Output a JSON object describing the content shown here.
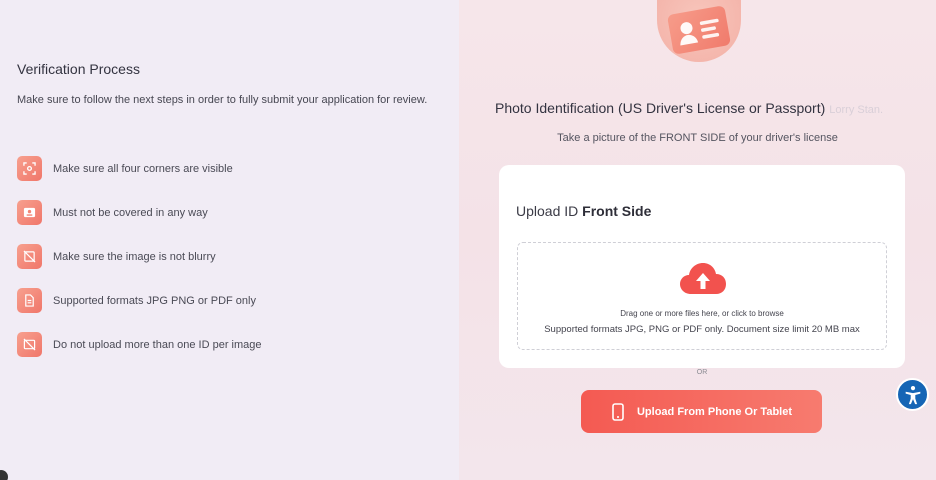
{
  "process": {
    "title": "Verification Process",
    "description": "Make sure to follow the next steps in order to fully submit your application for review.",
    "steps": [
      {
        "label": "Make sure all four corners are visible",
        "icon": "corners-icon"
      },
      {
        "label": "Must not be covered in any way",
        "icon": "card-icon"
      },
      {
        "label": "Make sure the image is not blurry",
        "icon": "blur-icon"
      },
      {
        "label": "Supported formats JPG PNG or PDF only",
        "icon": "file-icon"
      },
      {
        "label": "Do not upload more than one ID per image",
        "icon": "no-image-icon"
      }
    ]
  },
  "upload": {
    "heading": "Photo Identification (US Driver's License or Passport)",
    "heading_faded": "Lorry Stan.",
    "hint": "Take a picture of the FRONT SIDE of your driver's license",
    "card_title_prefix": "Upload ID",
    "card_title_bold": "Front Side",
    "drop_line1": "Drag one or more files here, or click to browse",
    "drop_line2": "Supported formats JPG, PNG or PDF only. Document size limit 20 MB max",
    "or": "OR",
    "phone_button": "Upload From Phone Or Tablet"
  },
  "colors": {
    "accent": "#f45a52",
    "accent_light": "#f7a08e",
    "accessibility": "#1565b5"
  }
}
